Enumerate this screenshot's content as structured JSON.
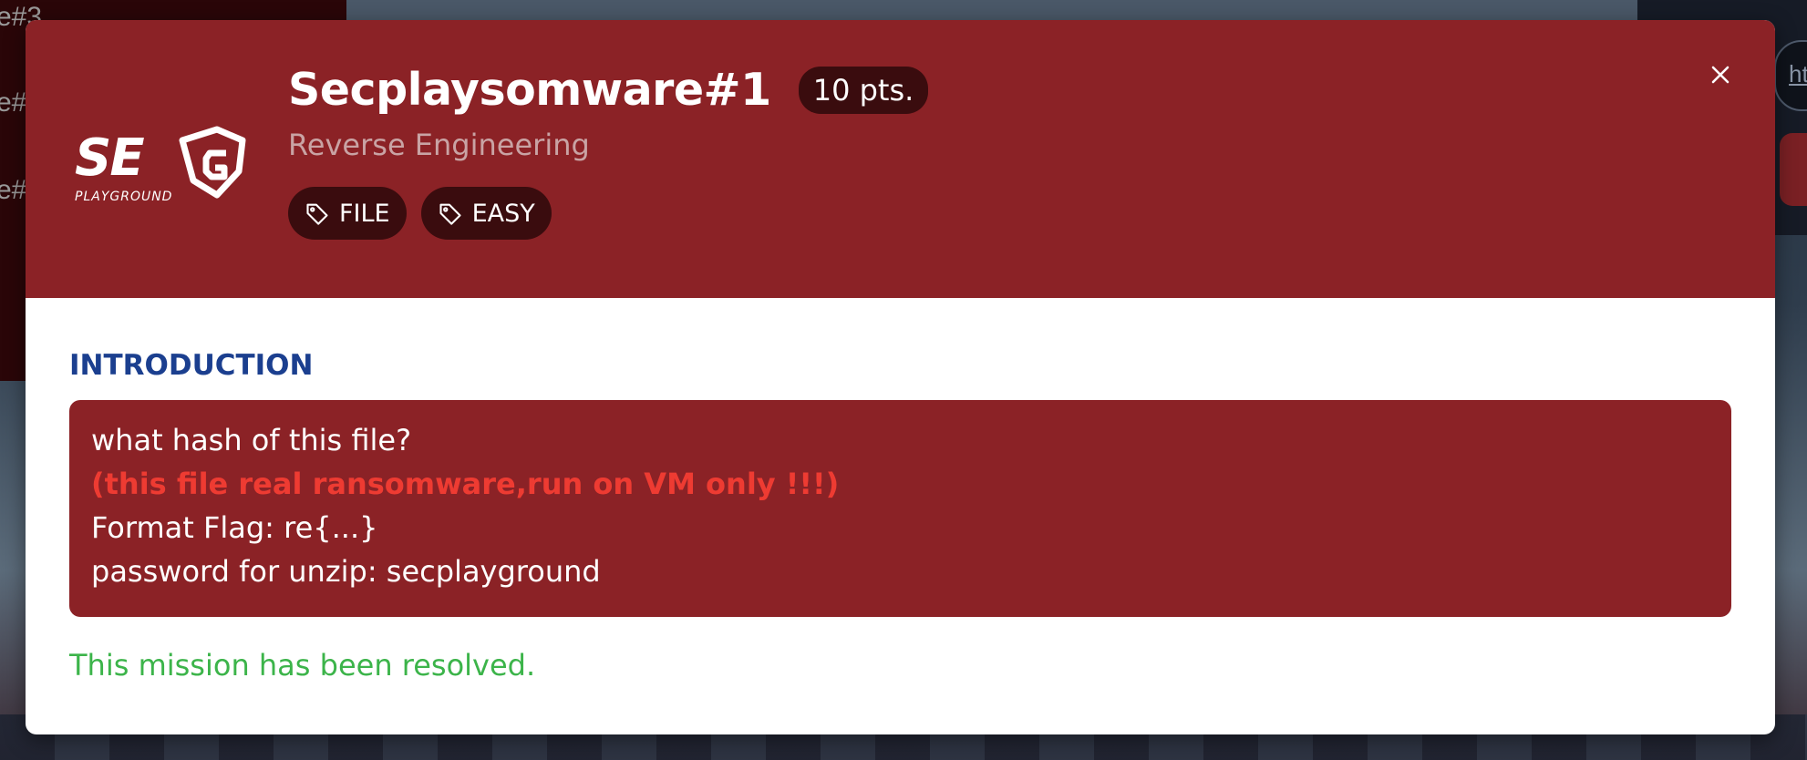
{
  "background": {
    "left_items": [
      "e#3",
      "e#",
      "e#"
    ],
    "right_link": "ht"
  },
  "challenge": {
    "logo_text": "SE",
    "logo_subtext": "PLAYGROUND",
    "title": "Secplaysomware#1",
    "points": "10 pts.",
    "category": "Reverse Engineering",
    "tags": [
      {
        "label": "FILE",
        "icon": "tag-icon"
      },
      {
        "label": "EASY",
        "icon": "tag-icon"
      }
    ],
    "close_icon": "close-icon"
  },
  "body": {
    "section_title": "INTRODUCTION",
    "intro_lines": [
      "what hash of this file?",
      "(this file real ransomware,run on VM only !!!)",
      "Format Flag: re{...}",
      "password for unzip: secplayground"
    ],
    "status": "This mission has been resolved."
  },
  "colors": {
    "header_bg": "#8b2226",
    "tag_bg": "#3a0c0e",
    "section_title": "#1b3f8f",
    "warning": "#ee3b32",
    "resolved": "#3cb44a"
  }
}
